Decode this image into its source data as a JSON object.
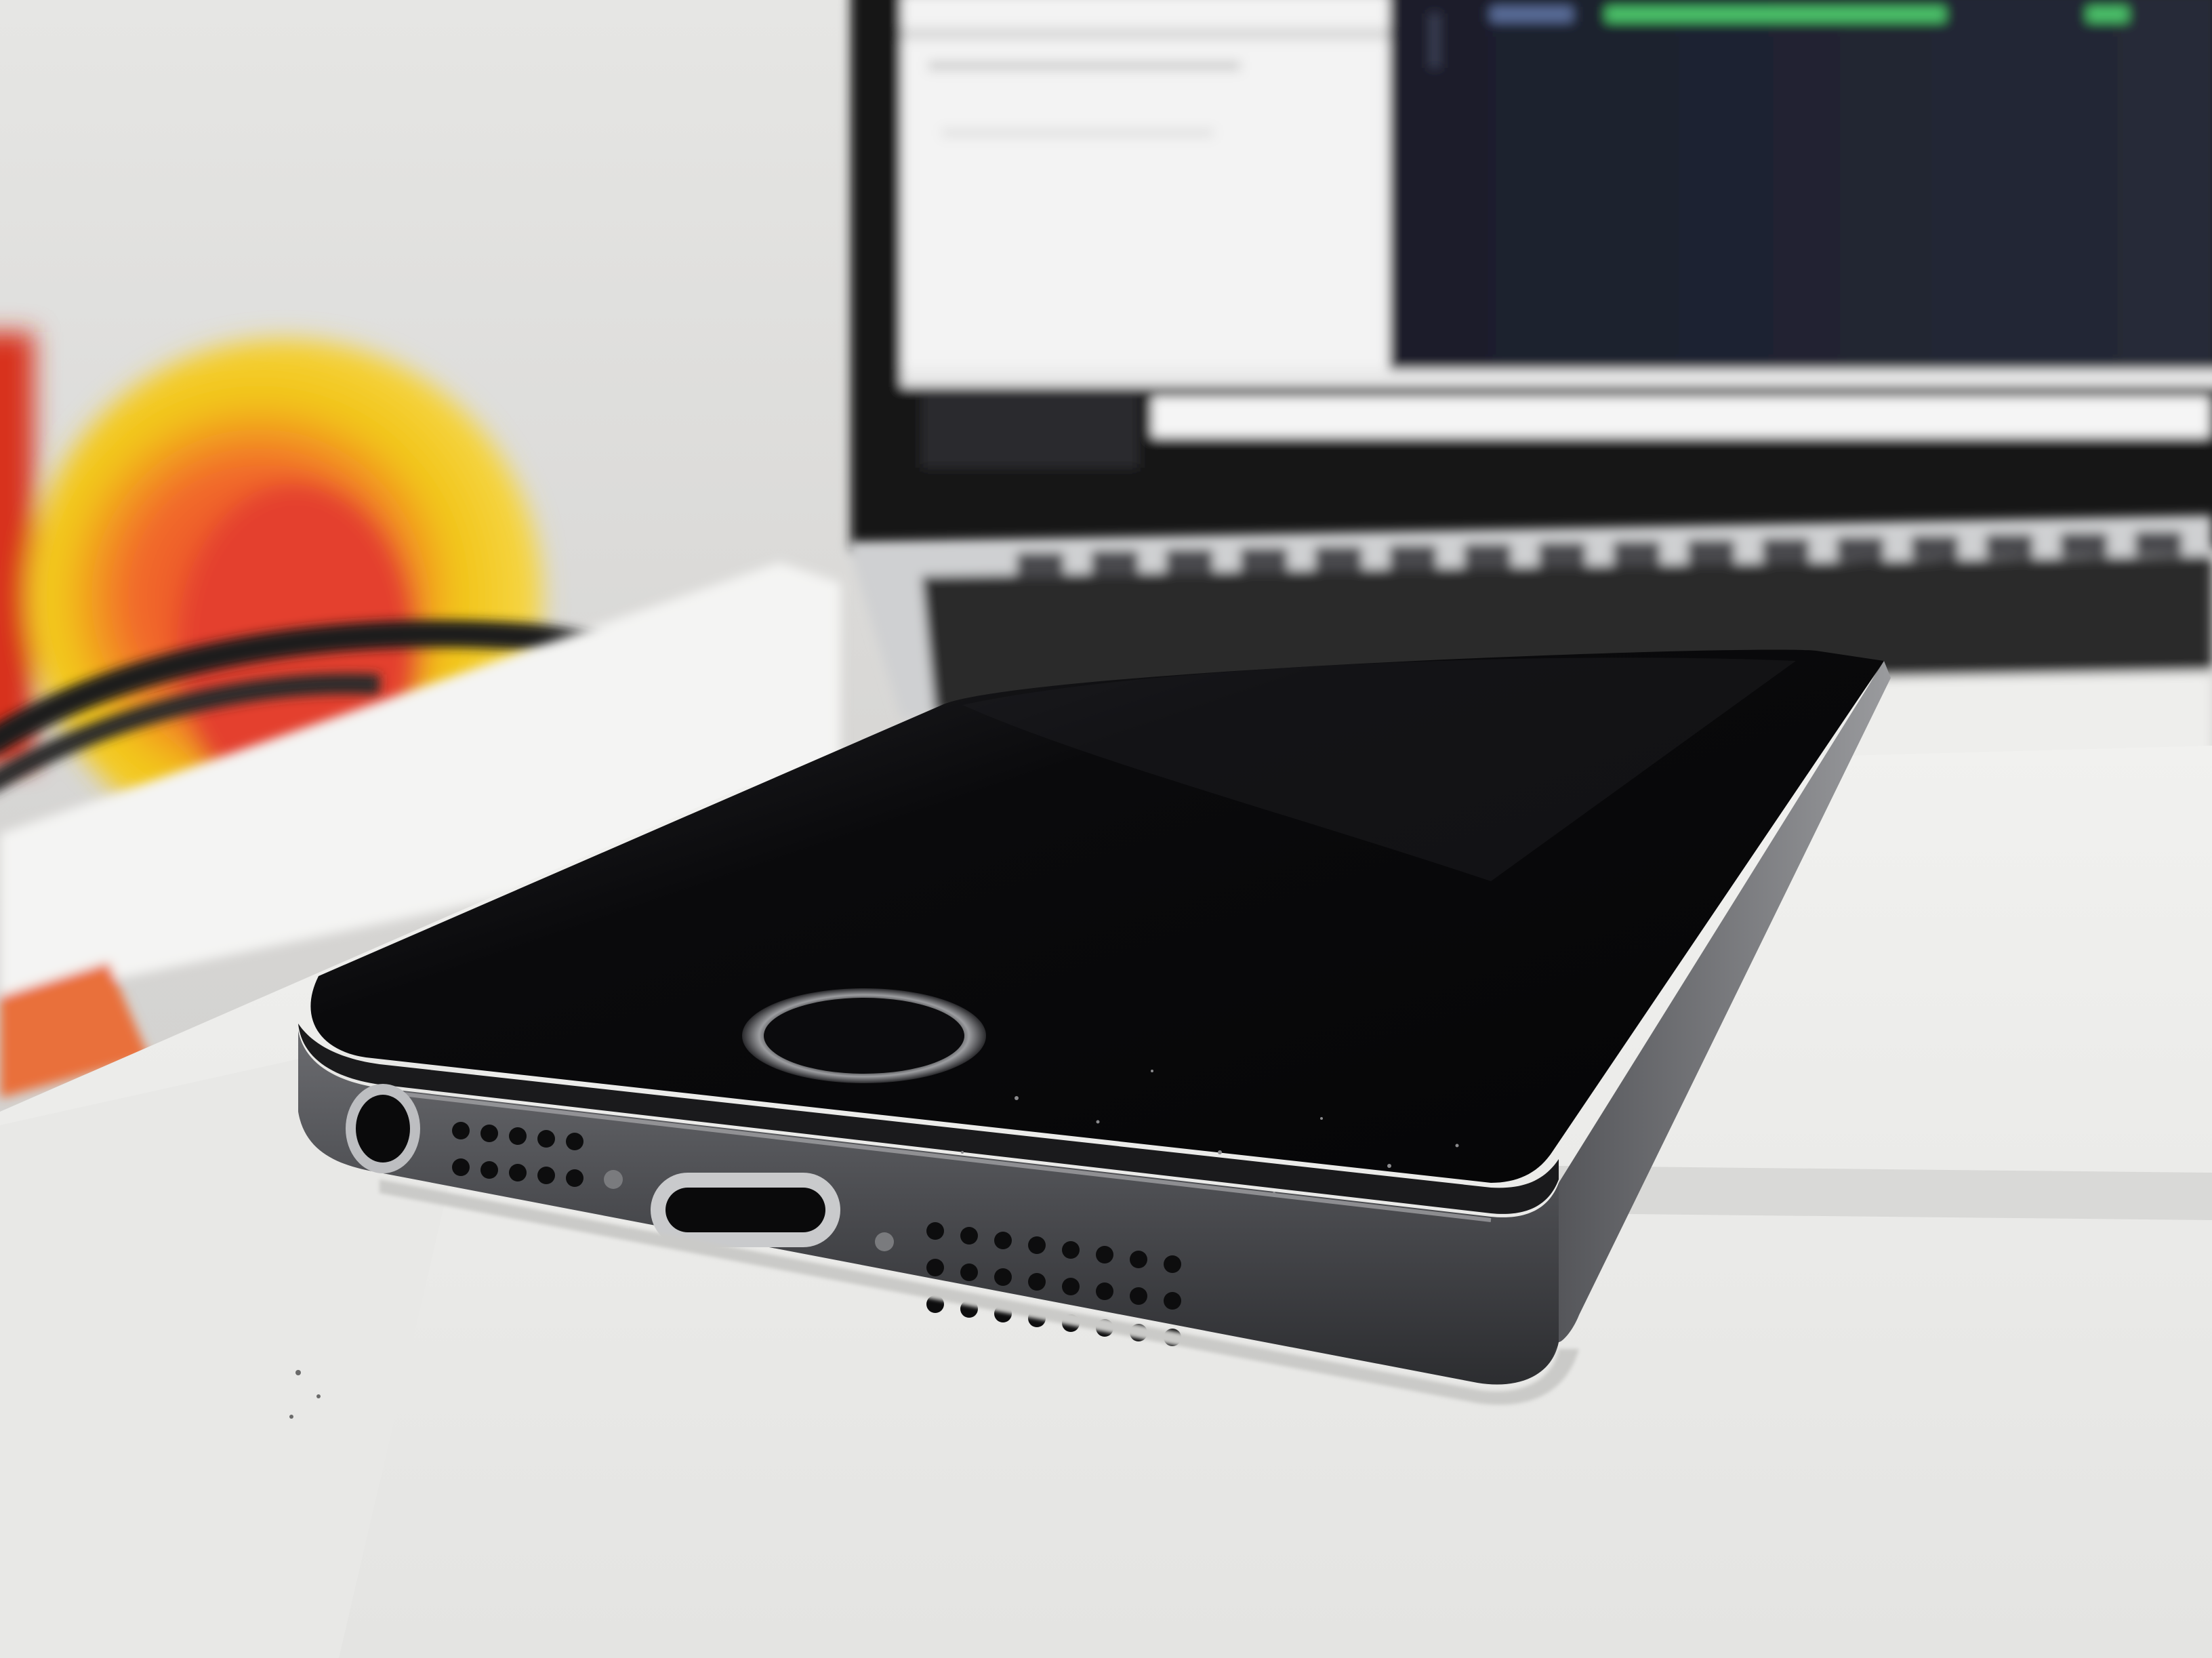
{
  "scene": {
    "subject": "smartphone-bottom-edge",
    "background": "laptop-on-desk",
    "palette": {
      "wall": "#d8d8d6",
      "desk": "#ededeb",
      "phone_glass": "#0b0b0d",
      "phone_frame": "#4a4b4f",
      "laptop_bezel": "#1c1c1e",
      "laptop_screen_terminal": "#1e2230",
      "laptop_screen_window": "#f3f3f3",
      "charm_yellow": "#f2c417",
      "charm_red": "#e0442c"
    }
  }
}
